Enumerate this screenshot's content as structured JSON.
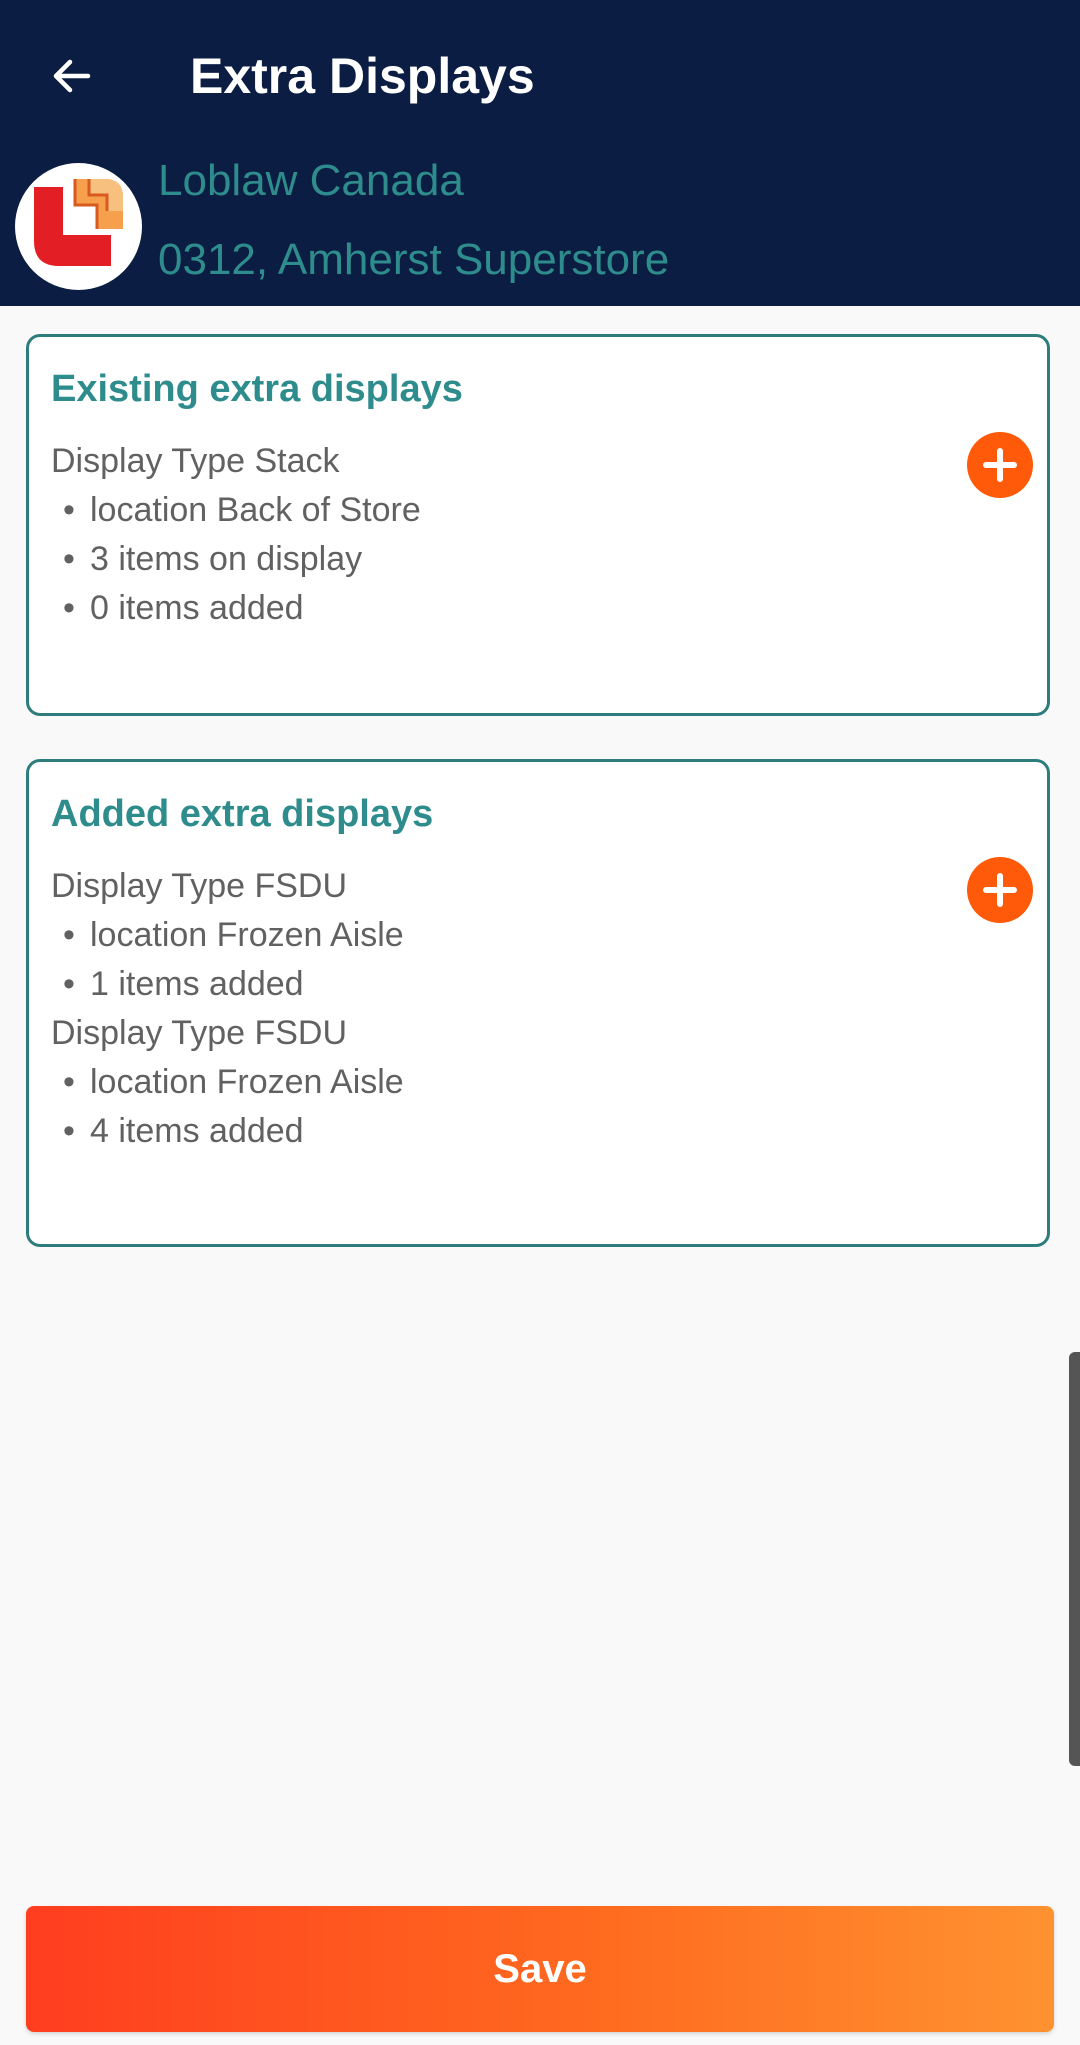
{
  "header": {
    "title": "Extra Displays",
    "back_icon": "arrow-left-icon"
  },
  "store": {
    "logo_icon": "loblaw-logo",
    "company": "Loblaw Canada",
    "location": "0312, Amherst Superstore"
  },
  "existing_section": {
    "title": "Existing extra displays",
    "add_icon": "plus-circle-icon",
    "lines": [
      {
        "text": "Display Type Stack",
        "bullet": false
      },
      {
        "text": "location Back of Store",
        "bullet": true
      },
      {
        "text": "3 items on display",
        "bullet": true
      },
      {
        "text": "0 items added",
        "bullet": true
      }
    ]
  },
  "added_section": {
    "title": "Added extra displays",
    "add_icon": "plus-circle-icon",
    "lines": [
      {
        "text": "Display Type FSDU",
        "bullet": false
      },
      {
        "text": "location Frozen Aisle",
        "bullet": true
      },
      {
        "text": "1 items added",
        "bullet": true
      },
      {
        "text": "Display Type FSDU",
        "bullet": false
      },
      {
        "text": "location Frozen Aisle",
        "bullet": true
      },
      {
        "text": "4 items added",
        "bullet": true
      }
    ]
  },
  "footer": {
    "save_label": "Save"
  },
  "colors": {
    "header_bg": "#0b1d42",
    "accent_teal": "#2e8c8c",
    "accent_orange": "#ff5a0a"
  }
}
